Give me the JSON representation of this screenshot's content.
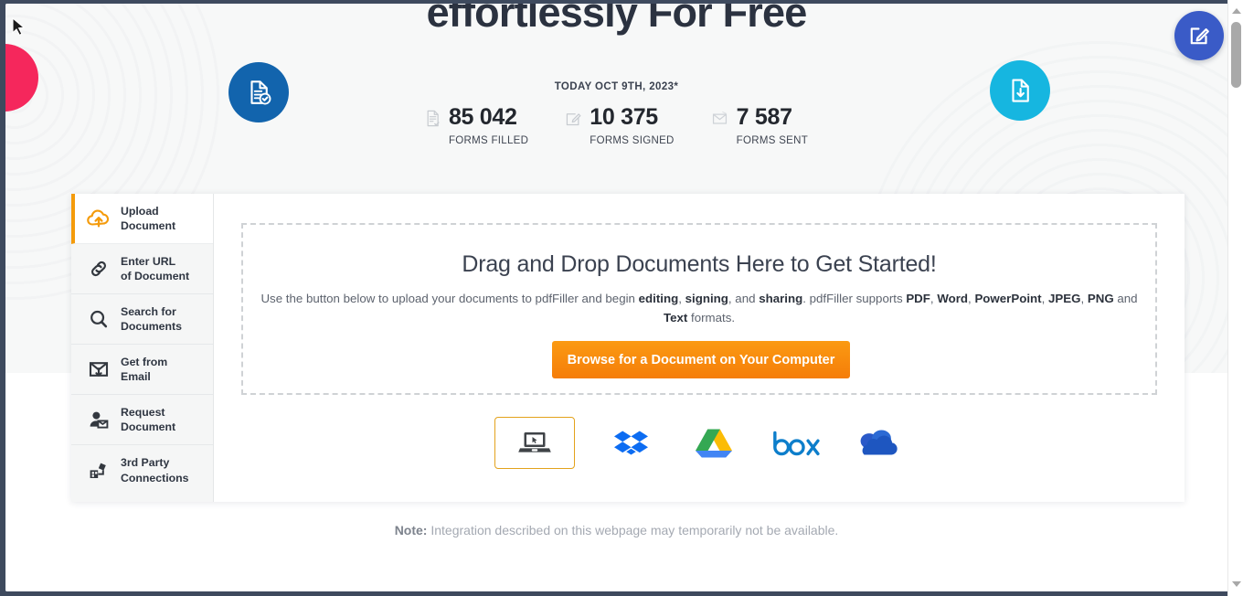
{
  "headline": "effortlessly For Free",
  "stats": {
    "date_label": "TODAY OCT 9TH, 2023*",
    "items": [
      {
        "icon": "document-check-icon",
        "value": "85 042",
        "label": "FORMS FILLED"
      },
      {
        "icon": "pencil-square-icon",
        "value": "10 375",
        "label": "FORMS SIGNED"
      },
      {
        "icon": "envelope-icon",
        "value": "7 587",
        "label": "FORMS SENT"
      }
    ]
  },
  "badges": {
    "left": {
      "icon": "document-check-badge-icon",
      "color": "#1264ad"
    },
    "right": {
      "icon": "document-download-badge-icon",
      "color": "#16b6e0"
    }
  },
  "sidebar": {
    "items": [
      {
        "icon": "cloud-upload-icon",
        "label": "Upload\nDocument",
        "active": true
      },
      {
        "icon": "link-chain-icon",
        "label": "Enter URL\nof Document",
        "active": false
      },
      {
        "icon": "magnifier-icon",
        "label": "Search for\nDocuments",
        "active": false
      },
      {
        "icon": "email-download-icon",
        "label": "Get from\nEmail",
        "active": false
      },
      {
        "icon": "person-envelope-icon",
        "label": "Request\nDocument",
        "active": false
      },
      {
        "icon": "puzzle-connect-icon",
        "label": "3rd Party\nConnections",
        "active": false
      }
    ]
  },
  "drop_area": {
    "title": "Drag and Drop Documents Here to Get Started!",
    "description_parts": [
      {
        "text": "Use the button below to upload your documents to pdfFiller and begin ",
        "bold": false
      },
      {
        "text": "editing",
        "bold": true
      },
      {
        "text": ", ",
        "bold": false
      },
      {
        "text": "signing",
        "bold": true
      },
      {
        "text": ", and ",
        "bold": false
      },
      {
        "text": "sharing",
        "bold": true
      },
      {
        "text": ". pdfFiller supports ",
        "bold": false
      },
      {
        "text": "PDF",
        "bold": true
      },
      {
        "text": ", ",
        "bold": false
      },
      {
        "text": "Word",
        "bold": true
      },
      {
        "text": ", ",
        "bold": false
      },
      {
        "text": "PowerPoint",
        "bold": true
      },
      {
        "text": ", ",
        "bold": false
      },
      {
        "text": "JPEG",
        "bold": true
      },
      {
        "text": ", ",
        "bold": false
      },
      {
        "text": "PNG",
        "bold": true
      },
      {
        "text": " and ",
        "bold": false
      },
      {
        "text": "Text",
        "bold": true
      },
      {
        "text": " formats.",
        "bold": false
      }
    ],
    "browse_button": "Browse for a Document on Your Computer"
  },
  "services": [
    {
      "name": "my-computer",
      "icon": "laptop-icon",
      "selected": true
    },
    {
      "name": "dropbox",
      "icon": "dropbox-icon",
      "selected": false
    },
    {
      "name": "google-drive",
      "icon": "googledrive-icon",
      "selected": false
    },
    {
      "name": "box",
      "icon": "box-icon",
      "selected": false
    },
    {
      "name": "onedrive",
      "icon": "onedrive-icon",
      "selected": false
    }
  ],
  "note": {
    "prefix": "Note:",
    "text": " Integration described on this webpage may temporarily not be available."
  },
  "fab": {
    "icon": "edit-square-icon",
    "color": "#3a5bc7"
  },
  "colors": {
    "accent_orange": "#f49b0b",
    "button_orange": "#f57d09",
    "hero_bg": "#f7f8f8",
    "text_dark": "#2f3642",
    "pink_blob": "#f5275c",
    "chrome_border": "#3e4a5e"
  }
}
